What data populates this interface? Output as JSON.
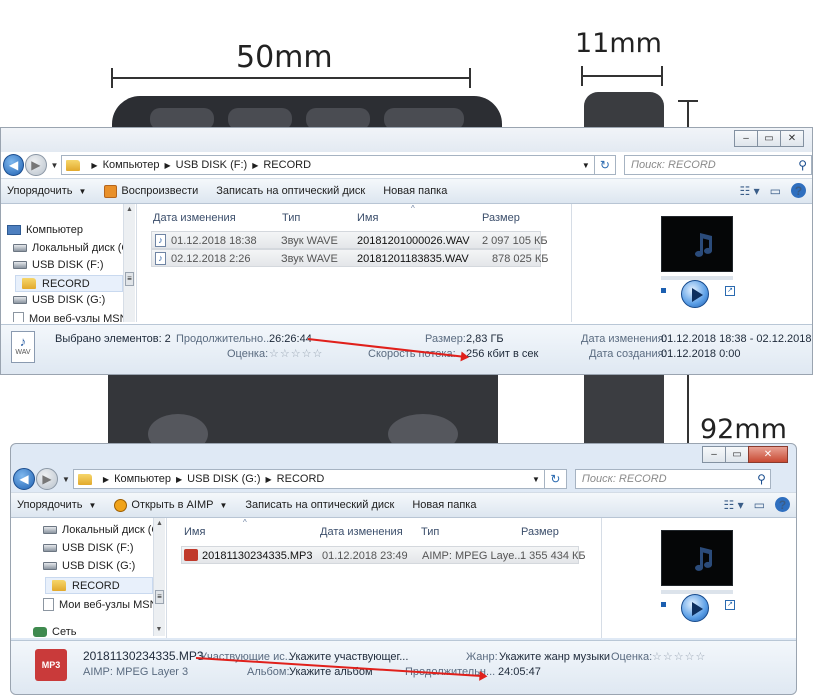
{
  "photo": {
    "width_label": "50mm",
    "depth_label": "11mm",
    "height_label": "92mm"
  },
  "window1": {
    "nav": {
      "back": "back",
      "forward": "forward"
    },
    "address": {
      "crumbs": [
        "Компьютер",
        "USB DISK (F:)",
        "RECORD"
      ]
    },
    "search_placeholder": "Поиск: RECORD",
    "toolbar": {
      "organize": "Упорядочить",
      "play": "Воспроизвести",
      "burn": "Записать на оптический диск",
      "new_folder": "Новая папка"
    },
    "nav_pane": [
      "Компьютер",
      "Локальный диск (C:",
      "USB DISK (F:)",
      "RECORD",
      "USB DISK (G:)",
      "Мои веб-узлы MSN"
    ],
    "columns": {
      "date": "Дата изменения",
      "type": "Тип",
      "name": "Имя",
      "size": "Размер"
    },
    "files": [
      {
        "date": "01.12.2018 18:38",
        "type": "Звук WAVE",
        "name": "20181201000026.WAV",
        "size": "2 097 105 КБ"
      },
      {
        "date": "02.12.2018 2:26",
        "type": "Звук WAVE",
        "name": "20181201183835.WAV",
        "size": "878 025 КБ"
      }
    ],
    "details": {
      "icon_label": "WAV",
      "selected": "Выбрано элементов: 2",
      "duration_label": "Продолжительно...",
      "duration": "26:26:44",
      "rating_label": "Оценка:",
      "rating_stars": "☆☆☆☆☆",
      "size_label": "Размер:",
      "size": "2,83 ГБ",
      "bitrate_label": "Скорость потока:",
      "bitrate": "256 кбит в сек",
      "modified_label": "Дата изменения:",
      "modified": "01.12.2018 18:38 - 02.12.2018 2:26",
      "created_label": "Дата создания:",
      "created": "01.12.2018 0:00"
    }
  },
  "window2": {
    "address": {
      "crumbs": [
        "Компьютер",
        "USB DISK (G:)",
        "RECORD"
      ]
    },
    "search_placeholder": "Поиск: RECORD",
    "toolbar": {
      "organize": "Упорядочить",
      "open_aimp": "Открыть в AIMP",
      "burn": "Записать на оптический диск",
      "new_folder": "Новая папка"
    },
    "nav_pane": [
      "Локальный диск (C:",
      "USB DISK (F:)",
      "USB DISK (G:)",
      "RECORD",
      "Мои веб-узлы MSN",
      "Сеть"
    ],
    "columns": {
      "name": "Имя",
      "date": "Дата изменения",
      "type": "Тип",
      "size": "Размер"
    },
    "files": [
      {
        "name": "20181130234335.MP3",
        "date": "01.12.2018 23:49",
        "type": "AIMP: MPEG Laye...",
        "size": "1 355 434 КБ"
      }
    ],
    "details": {
      "icon_label": "MP3",
      "filename": "20181130234335.MP3",
      "filetype": "AIMP: MPEG Layer 3",
      "artists_label": "Участвующие ис...",
      "artists": "Укажите участвующег...",
      "album_label": "Альбом:",
      "album": "Укажите альбом",
      "genre_label": "Жанр:",
      "genre": "Укажите жанр музыки",
      "duration_label": "Продолжительн...",
      "duration": "24:05:47",
      "rating_label": "Оценка:",
      "rating_stars": "☆☆☆☆☆"
    }
  }
}
